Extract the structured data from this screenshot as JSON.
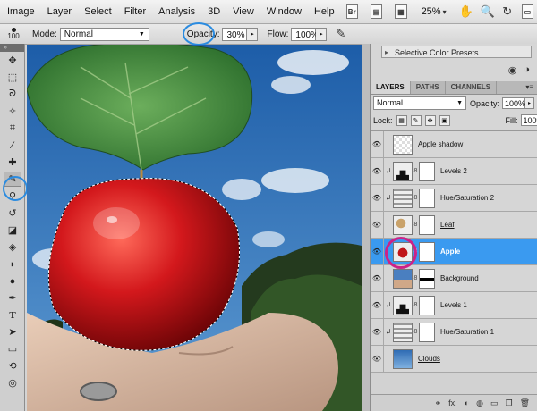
{
  "menu": {
    "items": [
      "Image",
      "Layer",
      "Select",
      "Filter",
      "Analysis",
      "3D",
      "View",
      "Window",
      "Help"
    ],
    "zoom": "25%"
  },
  "icons": {
    "bridge": "Br",
    "hand": "✋",
    "zoom": "🔍",
    "rotate": "↻"
  },
  "options": {
    "brush_size": "100",
    "mode_label": "Mode:",
    "mode_value": "Normal",
    "opacity_label": "Opacity:",
    "opacity_value": "30%",
    "flow_label": "Flow:",
    "flow_value": "100%"
  },
  "presets": {
    "label": "Selective Color Presets"
  },
  "layers_panel": {
    "tabs": [
      "LAYERS",
      "PATHS",
      "CHANNELS"
    ],
    "menu_icon": "▾≡",
    "blend_mode": "Normal",
    "opacity_label": "Opacity:",
    "opacity_value": "100%",
    "lock_label": "Lock:",
    "fill_label": "Fill:",
    "fill_value": "100%",
    "layers": [
      {
        "name": "Apple shadow",
        "type": "pixel"
      },
      {
        "name": "Levels 2",
        "type": "levels"
      },
      {
        "name": "Hue/Saturation 2",
        "type": "huesat"
      },
      {
        "name": "Leaf",
        "type": "leaf"
      },
      {
        "name": "Apple",
        "type": "apple",
        "selected": true
      },
      {
        "name": "Background",
        "type": "background"
      },
      {
        "name": "Levels 1",
        "type": "levels"
      },
      {
        "name": "Hue/Saturation 1",
        "type": "huesat"
      },
      {
        "name": "Clouds",
        "type": "clouds"
      }
    ],
    "footer_icons": [
      "⚭",
      "fx.",
      "◐",
      "◍",
      "▭",
      "❐",
      "🗑"
    ]
  },
  "colors": {
    "selected_layer": "#3a9af0",
    "highlight_blue": "#2a8be0",
    "highlight_magenta": "#cc2288",
    "sky": "#2c6fb0"
  }
}
